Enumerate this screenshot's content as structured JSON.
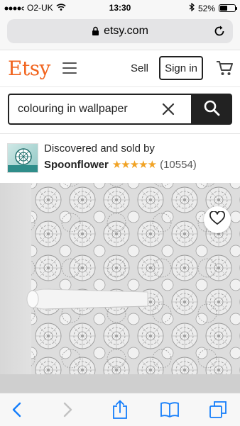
{
  "status_bar": {
    "carrier": "O2-UK",
    "time": "13:30",
    "battery": "52%",
    "battery_level": 0.52
  },
  "browser": {
    "url": "etsy.com"
  },
  "header": {
    "logo": "Etsy",
    "sell_label": "Sell",
    "signin_label": "Sign in"
  },
  "search": {
    "value": "colouring in wallpaper"
  },
  "seller": {
    "intro": "Discovered and sold by",
    "shop_name": "Spoonflower",
    "rating_stars": "★★★★★",
    "review_count": "(10554)",
    "rating": 5
  },
  "colors": {
    "brand": "#f1641e",
    "star": "#f1a325",
    "ios_blue": "#147efb"
  },
  "icons": [
    "wifi-icon",
    "lock-icon",
    "reload-icon",
    "menu-icon",
    "cart-icon",
    "clear-icon",
    "search-icon",
    "heart-icon",
    "back-icon",
    "forward-icon",
    "share-icon",
    "bookmarks-icon",
    "tabs-icon"
  ]
}
